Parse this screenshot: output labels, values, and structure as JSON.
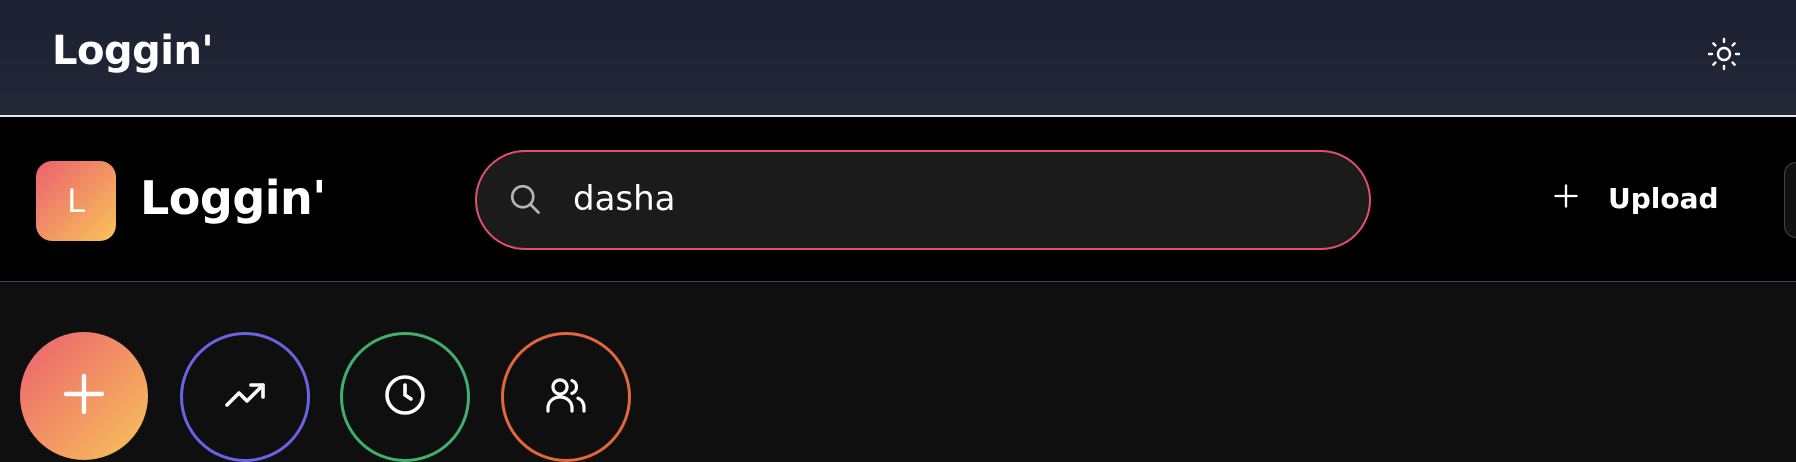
{
  "topbar": {
    "title": "Loggin'",
    "theme_icon": "sun-icon"
  },
  "header": {
    "logo_letter": "L",
    "logo_text": "Loggin'",
    "search": {
      "value": "dasha",
      "icon": "search-icon"
    },
    "upload_label": "Upload"
  },
  "actions": [
    {
      "name": "add",
      "icon": "plus-icon",
      "color": "#ec6071"
    },
    {
      "name": "trending",
      "icon": "trending-up-icon",
      "color": "#6a64e4"
    },
    {
      "name": "recent",
      "icon": "clock-icon",
      "color": "#41b06c"
    },
    {
      "name": "friends",
      "icon": "users-icon",
      "color": "#e2673c"
    }
  ]
}
